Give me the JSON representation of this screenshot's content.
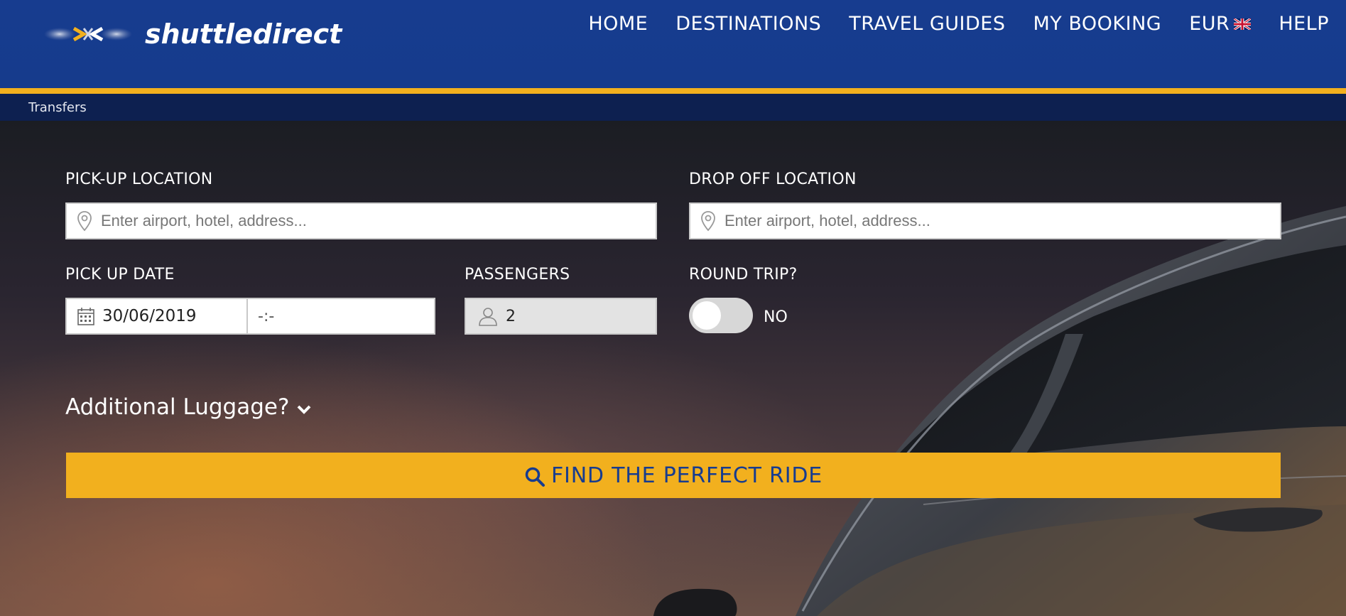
{
  "header": {
    "logo_text": "shuttledirect",
    "nav": [
      {
        "label": "HOME"
      },
      {
        "label": "DESTINATIONS"
      },
      {
        "label": "TRAVEL GUIDES"
      },
      {
        "label": "MY BOOKING"
      },
      {
        "label": "EUR",
        "icon": "uk-flag-icon"
      },
      {
        "label": "HELP"
      }
    ]
  },
  "breadcrumb": "Transfers",
  "form": {
    "pickup_label": "PICK-UP LOCATION",
    "pickup_placeholder": "Enter airport, hotel, address...",
    "dropoff_label": "DROP OFF LOCATION",
    "dropoff_placeholder": "Enter airport, hotel, address...",
    "date_label": "PICK UP DATE",
    "date_value": "30/06/2019",
    "time_value": "-:-",
    "passengers_label": "PASSENGERS",
    "passengers_value": "2",
    "roundtrip_label": "ROUND TRIP?",
    "roundtrip_value": "NO",
    "luggage_label": "Additional Luggage?",
    "submit_label": "FIND THE PERFECT RIDE"
  },
  "colors": {
    "header_blue": "#173c8f",
    "accent_gold": "#f2b01e",
    "subbar_navy": "#0d2050"
  }
}
